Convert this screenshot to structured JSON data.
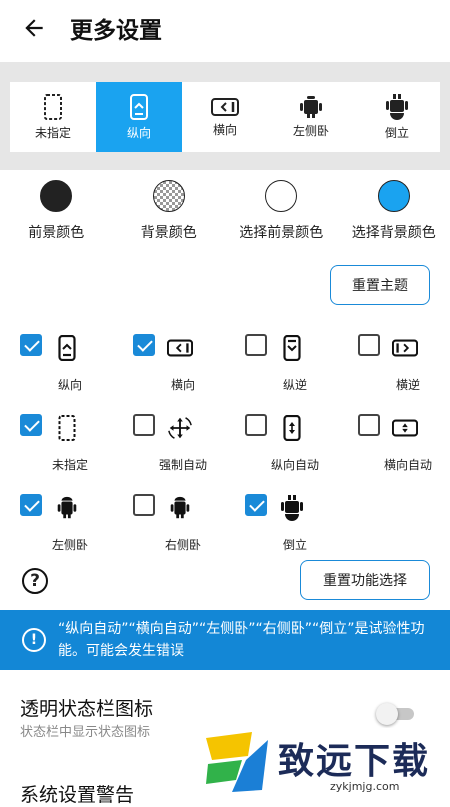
{
  "header": {
    "title": "更多设置"
  },
  "orientation_bar": {
    "items": [
      {
        "label": "未指定",
        "icon": "unspecified-icon",
        "selected": false
      },
      {
        "label": "纵向",
        "icon": "portrait-icon",
        "selected": true
      },
      {
        "label": "横向",
        "icon": "landscape-icon",
        "selected": false
      },
      {
        "label": "左侧卧",
        "icon": "android-left-icon",
        "selected": false
      },
      {
        "label": "倒立",
        "icon": "android-upside-down-icon",
        "selected": false
      }
    ]
  },
  "colors": {
    "items": [
      {
        "label": "前景颜色",
        "value": "#222222"
      },
      {
        "label": "背景颜色",
        "value": "checker"
      },
      {
        "label": "选择前景颜色",
        "value": "#ffffff"
      },
      {
        "label": "选择背景颜色",
        "value": "#1aa3f0"
      }
    ],
    "accent": "#1a8ad8"
  },
  "reset_theme_button": "重置主题",
  "functions": [
    {
      "label": "纵向",
      "checked": true,
      "icon": "portrait-icon"
    },
    {
      "label": "横向",
      "checked": true,
      "icon": "landscape-icon"
    },
    {
      "label": "纵逆",
      "checked": false,
      "icon": "reverse-portrait-icon"
    },
    {
      "label": "横逆",
      "checked": false,
      "icon": "reverse-landscape-icon"
    },
    {
      "label": "未指定",
      "checked": true,
      "icon": "unspecified-icon"
    },
    {
      "label": "强制自动",
      "checked": false,
      "icon": "force-auto-rotate-icon"
    },
    {
      "label": "纵向自动",
      "checked": false,
      "icon": "portrait-auto-icon"
    },
    {
      "label": "横向自动",
      "checked": false,
      "icon": "landscape-auto-icon"
    },
    {
      "label": "左侧卧",
      "checked": true,
      "icon": "android-left-icon"
    },
    {
      "label": "右侧卧",
      "checked": false,
      "icon": "android-right-icon"
    },
    {
      "label": "倒立",
      "checked": true,
      "icon": "android-upside-down-icon"
    }
  ],
  "help_icon": "?",
  "reset_functions_button": "重置功能选择",
  "notice": {
    "text": "“纵向自动”“横向自动”“左侧卧”“右侧卧”“倒立”是试验性功能。可能会发生错误",
    "color": "#1387d6"
  },
  "settings": [
    {
      "title": "透明状态栏图标",
      "subtitle": "状态栏中显示状态图标",
      "enabled": false
    },
    {
      "title": "系统设置警告"
    }
  ],
  "watermark": {
    "text": "致远下载",
    "url": "zykjmjg.com"
  }
}
